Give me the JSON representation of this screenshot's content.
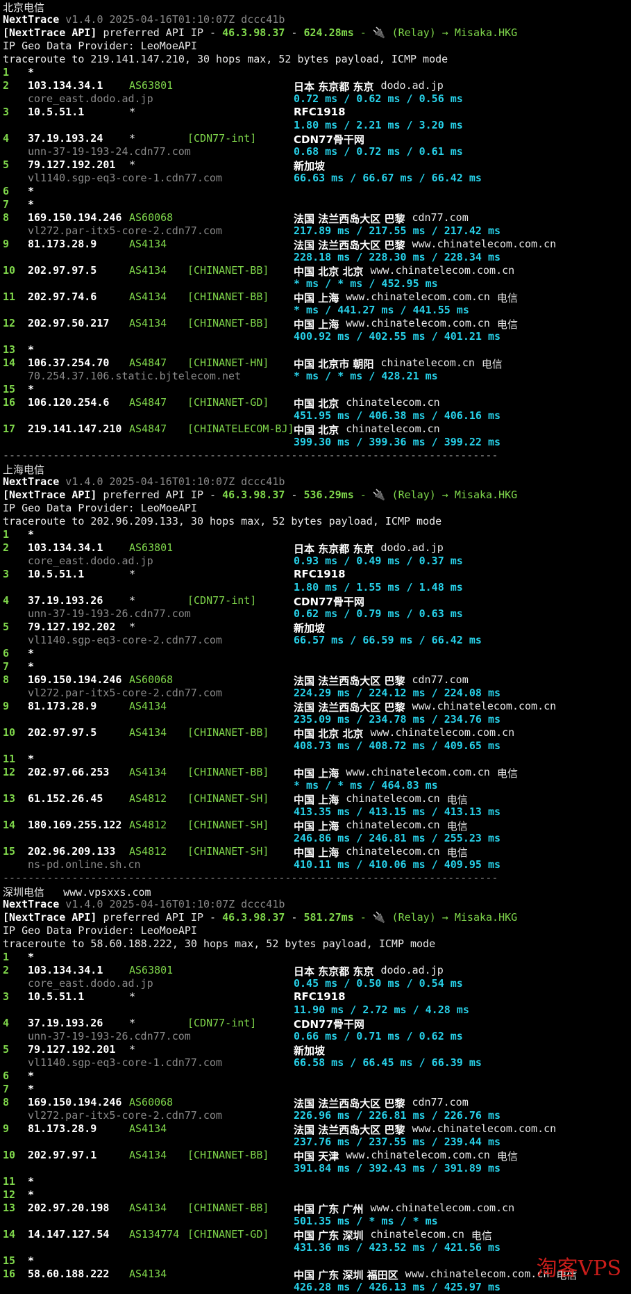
{
  "watermark": "淘客VPS",
  "watermark_site": "www.vpsxxs.com",
  "sections": [
    {
      "title": "北京电信",
      "header": {
        "app_name": "NextTrace",
        "version": "v1.4.0 2025-04-16T01:10:07Z dccc41b",
        "api_tag": "[NextTrace API]",
        "api_mid": " preferred API IP - ",
        "api_ip": "46.3.98.37",
        "api_sep": " - ",
        "api_latency": "624.28ms",
        "api_route": " - 🔌 (Relay) → Misaka.HKG",
        "geo_provider": "IP Geo Data Provider: LeoMoeAPI",
        "traceroute": "traceroute to 219.141.147.210, 30 hops max, 52 bytes payload, ICMP mode"
      },
      "hops": [
        {
          "n": "1",
          "ip": "*"
        },
        {
          "n": "2",
          "ip": "103.134.34.1",
          "asn": "AS63801",
          "tag": "",
          "geo": "日本 东京都 东京",
          "domain": "dodo.ad.jp",
          "isp": "",
          "ptr": "core_east.dodo.ad.jp",
          "rtt": "0.72 ms / 0.62 ms / 0.56 ms"
        },
        {
          "n": "3",
          "ip": "10.5.51.1",
          "asn": "*",
          "tag": "",
          "geo": "RFC1918",
          "domain": "",
          "isp": "",
          "ptr": "",
          "rtt": "1.80 ms / 2.21 ms / 3.20 ms"
        },
        {
          "n": "4",
          "ip": "37.19.193.24",
          "asn": "*",
          "tag": "[CDN77-int]",
          "geo": "CDN77骨干网",
          "domain": "",
          "isp": "",
          "ptr": "unn-37-19-193-24.cdn77.com",
          "rtt": "0.68 ms / 0.72 ms / 0.61 ms"
        },
        {
          "n": "5",
          "ip": "79.127.192.201",
          "asn": "*",
          "tag": "",
          "geo": "新加坡",
          "domain": "",
          "isp": "",
          "ptr": "vl1140.sgp-eq3-core-1.cdn77.com",
          "rtt": "66.63 ms / 66.67 ms / 66.42 ms"
        },
        {
          "n": "6",
          "ip": "*"
        },
        {
          "n": "7",
          "ip": "*"
        },
        {
          "n": "8",
          "ip": "169.150.194.246",
          "asn": "AS60068",
          "tag": "",
          "geo": "法国 法兰西岛大区 巴黎",
          "domain": "cdn77.com",
          "isp": "",
          "ptr": "vl272.par-itx5-core-2.cdn77.com",
          "rtt": "217.89 ms / 217.55 ms / 217.42 ms"
        },
        {
          "n": "9",
          "ip": "81.173.28.9",
          "asn": "AS4134",
          "tag": "",
          "geo": "法国 法兰西岛大区 巴黎",
          "domain": "www.chinatelecom.com.cn",
          "isp": "",
          "ptr": "",
          "rtt": "228.18 ms / 228.30 ms / 228.34 ms"
        },
        {
          "n": "10",
          "ip": "202.97.97.5",
          "asn": "AS4134",
          "tag": "[CHINANET-BB]",
          "geo": "中国 北京 北京",
          "domain": "www.chinatelecom.com.cn",
          "isp": "",
          "ptr": "",
          "rtt": "* ms / * ms / 452.95 ms"
        },
        {
          "n": "11",
          "ip": "202.97.74.6",
          "asn": "AS4134",
          "tag": "[CHINANET-BB]",
          "geo": "中国 上海",
          "domain": "www.chinatelecom.com.cn",
          "isp": "电信",
          "ptr": "",
          "rtt": "* ms / 441.27 ms / 441.55 ms"
        },
        {
          "n": "12",
          "ip": "202.97.50.217",
          "asn": "AS4134",
          "tag": "[CHINANET-BB]",
          "geo": "中国 上海",
          "domain": "www.chinatelecom.com.cn",
          "isp": "电信",
          "ptr": "",
          "rtt": "400.92 ms / 402.55 ms / 401.21 ms"
        },
        {
          "n": "13",
          "ip": "*"
        },
        {
          "n": "14",
          "ip": "106.37.254.70",
          "asn": "AS4847",
          "tag": "[CHINANET-HN]",
          "geo": "中国 北京市 朝阳",
          "domain": "chinatelecom.cn",
          "isp": "电信",
          "ptr": "70.254.37.106.static.bjtelecom.net",
          "rtt": "* ms / * ms / 428.21 ms"
        },
        {
          "n": "15",
          "ip": "*"
        },
        {
          "n": "16",
          "ip": "106.120.254.6",
          "asn": "AS4847",
          "tag": "[CHINANET-GD]",
          "geo": "中国 北京",
          "domain": "chinatelecom.cn",
          "isp": "",
          "ptr": "",
          "rtt": "451.95 ms / 406.38 ms / 406.16 ms"
        },
        {
          "n": "17",
          "ip": "219.141.147.210",
          "asn": "AS4847",
          "tag": "[CHINATELECOM-BJ]",
          "geo": "中国 北京",
          "domain": "chinatelecom.cn",
          "isp": "",
          "ptr": "",
          "rtt": "399.30 ms / 399.36 ms / 399.22 ms"
        }
      ]
    },
    {
      "title": "上海电信",
      "header": {
        "app_name": "NextTrace",
        "version": "v1.4.0 2025-04-16T01:10:07Z dccc41b",
        "api_tag": "[NextTrace API]",
        "api_mid": " preferred API IP - ",
        "api_ip": "46.3.98.37",
        "api_sep": " - ",
        "api_latency": "536.29ms",
        "api_route": " - 🔌 (Relay) → Misaka.HKG",
        "geo_provider": "IP Geo Data Provider: LeoMoeAPI",
        "traceroute": "traceroute to 202.96.209.133, 30 hops max, 52 bytes payload, ICMP mode"
      },
      "hops": [
        {
          "n": "1",
          "ip": "*"
        },
        {
          "n": "2",
          "ip": "103.134.34.1",
          "asn": "AS63801",
          "tag": "",
          "geo": "日本 东京都 东京",
          "domain": "dodo.ad.jp",
          "isp": "",
          "ptr": "core_east.dodo.ad.jp",
          "rtt": "0.93 ms / 0.49 ms / 0.37 ms"
        },
        {
          "n": "3",
          "ip": "10.5.51.1",
          "asn": "*",
          "tag": "",
          "geo": "RFC1918",
          "domain": "",
          "isp": "",
          "ptr": "",
          "rtt": "1.80 ms / 1.55 ms / 1.48 ms"
        },
        {
          "n": "4",
          "ip": "37.19.193.26",
          "asn": "*",
          "tag": "[CDN77-int]",
          "geo": "CDN77骨干网",
          "domain": "",
          "isp": "",
          "ptr": "unn-37-19-193-26.cdn77.com",
          "rtt": "0.62 ms / 0.79 ms / 0.63 ms"
        },
        {
          "n": "5",
          "ip": "79.127.192.202",
          "asn": "*",
          "tag": "",
          "geo": "新加坡",
          "domain": "",
          "isp": "",
          "ptr": "vl1140.sgp-eq3-core-2.cdn77.com",
          "rtt": "66.57 ms / 66.59 ms / 66.42 ms"
        },
        {
          "n": "6",
          "ip": "*"
        },
        {
          "n": "7",
          "ip": "*"
        },
        {
          "n": "8",
          "ip": "169.150.194.246",
          "asn": "AS60068",
          "tag": "",
          "geo": "法国 法兰西岛大区 巴黎",
          "domain": "cdn77.com",
          "isp": "",
          "ptr": "vl272.par-itx5-core-2.cdn77.com",
          "rtt": "224.29 ms / 224.12 ms / 224.08 ms"
        },
        {
          "n": "9",
          "ip": "81.173.28.9",
          "asn": "AS4134",
          "tag": "",
          "geo": "法国 法兰西岛大区 巴黎",
          "domain": "www.chinatelecom.com.cn",
          "isp": "",
          "ptr": "",
          "rtt": "235.09 ms / 234.78 ms / 234.76 ms"
        },
        {
          "n": "10",
          "ip": "202.97.97.5",
          "asn": "AS4134",
          "tag": "[CHINANET-BB]",
          "geo": "中国 北京 北京",
          "domain": "www.chinatelecom.com.cn",
          "isp": "",
          "ptr": "",
          "rtt": "408.73 ms / 408.72 ms / 409.65 ms"
        },
        {
          "n": "11",
          "ip": "*"
        },
        {
          "n": "12",
          "ip": "202.97.66.253",
          "asn": "AS4134",
          "tag": "[CHINANET-BB]",
          "geo": "中国 上海",
          "domain": "www.chinatelecom.com.cn",
          "isp": "电信",
          "ptr": "",
          "rtt": "* ms / * ms / 464.83 ms"
        },
        {
          "n": "13",
          "ip": "61.152.26.45",
          "asn": "AS4812",
          "tag": "[CHINANET-SH]",
          "geo": "中国 上海",
          "domain": "chinatelecom.cn",
          "isp": "电信",
          "ptr": "",
          "rtt": "413.35 ms / 413.15 ms / 413.13 ms"
        },
        {
          "n": "14",
          "ip": "180.169.255.122",
          "asn": "AS4812",
          "tag": "[CHINANET-SH]",
          "geo": "中国 上海",
          "domain": "chinatelecom.cn",
          "isp": "电信",
          "ptr": "",
          "rtt": "246.86 ms / 246.81 ms / 255.23 ms"
        },
        {
          "n": "15",
          "ip": "202.96.209.133",
          "asn": "AS4812",
          "tag": "[CHINANET-SH]",
          "geo": "中国 上海",
          "domain": "chinatelecom.cn",
          "isp": "电信",
          "ptr": "ns-pd.online.sh.cn",
          "rtt": "410.11 ms / 410.06 ms / 409.95 ms"
        }
      ]
    },
    {
      "title": "深圳电信",
      "header": {
        "app_name": "NextTrace",
        "version": "v1.4.0 2025-04-16T01:10:07Z dccc41b",
        "api_tag": "[NextTrace API]",
        "api_mid": " preferred API IP - ",
        "api_ip": "46.3.98.37",
        "api_sep": " - ",
        "api_latency": "581.27ms",
        "api_route": " - 🔌 (Relay) → Misaka.HKG",
        "geo_provider": "IP Geo Data Provider: LeoMoeAPI",
        "traceroute": "traceroute to 58.60.188.222, 30 hops max, 52 bytes payload, ICMP mode"
      },
      "hops": [
        {
          "n": "1",
          "ip": "*"
        },
        {
          "n": "2",
          "ip": "103.134.34.1",
          "asn": "AS63801",
          "tag": "",
          "geo": "日本 东京都 东京",
          "domain": "dodo.ad.jp",
          "isp": "",
          "ptr": "core_east.dodo.ad.jp",
          "rtt": "0.45 ms / 0.50 ms / 0.54 ms"
        },
        {
          "n": "3",
          "ip": "10.5.51.1",
          "asn": "*",
          "tag": "",
          "geo": "RFC1918",
          "domain": "",
          "isp": "",
          "ptr": "",
          "rtt": "11.90 ms / 2.72 ms / 4.28 ms"
        },
        {
          "n": "4",
          "ip": "37.19.193.26",
          "asn": "*",
          "tag": "[CDN77-int]",
          "geo": "CDN77骨干网",
          "domain": "",
          "isp": "",
          "ptr": "unn-37-19-193-26.cdn77.com",
          "rtt": "0.66 ms / 0.71 ms / 0.62 ms"
        },
        {
          "n": "5",
          "ip": "79.127.192.201",
          "asn": "*",
          "tag": "",
          "geo": "新加坡",
          "domain": "",
          "isp": "",
          "ptr": "vl1140.sgp-eq3-core-1.cdn77.com",
          "rtt": "66.58 ms / 66.45 ms / 66.39 ms"
        },
        {
          "n": "6",
          "ip": "*"
        },
        {
          "n": "7",
          "ip": "*"
        },
        {
          "n": "8",
          "ip": "169.150.194.246",
          "asn": "AS60068",
          "tag": "",
          "geo": "法国 法兰西岛大区 巴黎",
          "domain": "cdn77.com",
          "isp": "",
          "ptr": "vl272.par-itx5-core-2.cdn77.com",
          "rtt": "226.96 ms / 226.81 ms / 226.76 ms"
        },
        {
          "n": "9",
          "ip": "81.173.28.9",
          "asn": "AS4134",
          "tag": "",
          "geo": "法国 法兰西岛大区 巴黎",
          "domain": "www.chinatelecom.com.cn",
          "isp": "",
          "ptr": "",
          "rtt": "237.76 ms / 237.55 ms / 239.44 ms"
        },
        {
          "n": "10",
          "ip": "202.97.97.1",
          "asn": "AS4134",
          "tag": "[CHINANET-BB]",
          "geo": "中国 天津",
          "domain": "www.chinatelecom.com.cn",
          "isp": "电信",
          "ptr": "",
          "rtt": "391.84 ms / 392.43 ms / 391.89 ms"
        },
        {
          "n": "11",
          "ip": "*"
        },
        {
          "n": "12",
          "ip": "*"
        },
        {
          "n": "13",
          "ip": "202.97.20.198",
          "asn": "AS4134",
          "tag": "[CHINANET-BB]",
          "geo": "中国 广东 广州",
          "domain": "www.chinatelecom.com.cn",
          "isp": "",
          "ptr": "",
          "rtt": "501.35 ms / * ms / * ms"
        },
        {
          "n": "14",
          "ip": "14.147.127.54",
          "asn": "AS134774",
          "tag": "[CHINANET-GD]",
          "geo": "中国 广东 深圳",
          "domain": "chinatelecom.cn",
          "isp": "电信",
          "ptr": "",
          "rtt": "431.36 ms / 423.52 ms / 421.56 ms"
        },
        {
          "n": "15",
          "ip": "*"
        },
        {
          "n": "16",
          "ip": "58.60.188.222",
          "asn": "AS4134",
          "tag": "",
          "geo": "中国 广东 深圳 福田区",
          "domain": "www.chinatelecom.com.cn",
          "isp": "电信",
          "ptr": "",
          "rtt": "426.28 ms / 426.13 ms / 425.97 ms"
        }
      ]
    }
  ],
  "separator": "-------------------------------------------------------------------------------"
}
